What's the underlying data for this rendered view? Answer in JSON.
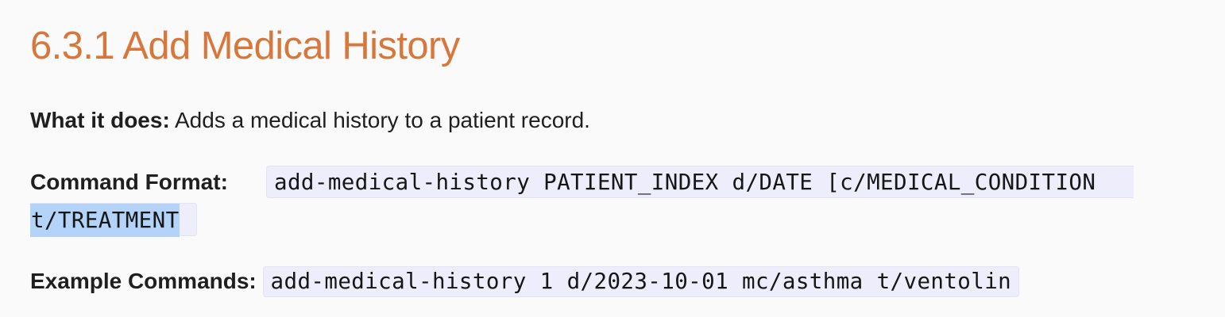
{
  "section": {
    "title": "6.3.1 Add Medical History"
  },
  "what_it_does": {
    "label": "What it does:",
    "text": " Adds a medical history to a patient record."
  },
  "command_format": {
    "label": "Command Format:",
    "code_line_1": "add-medical-history PATIENT_INDEX d/DATE [c/MEDICAL_CONDITION",
    "code_line_2": "t/TREATMENT",
    "selected_text": "t/TREATMENT"
  },
  "example_commands": {
    "label": "Example Commands:",
    "code": "add-medical-history 1 d/2023-10-01 mc/asthma t/ventolin"
  },
  "colors": {
    "heading": "#d7773c",
    "code_background": "#ededfb",
    "selection": "#b3d3f8",
    "text": "#1f1f1f"
  }
}
